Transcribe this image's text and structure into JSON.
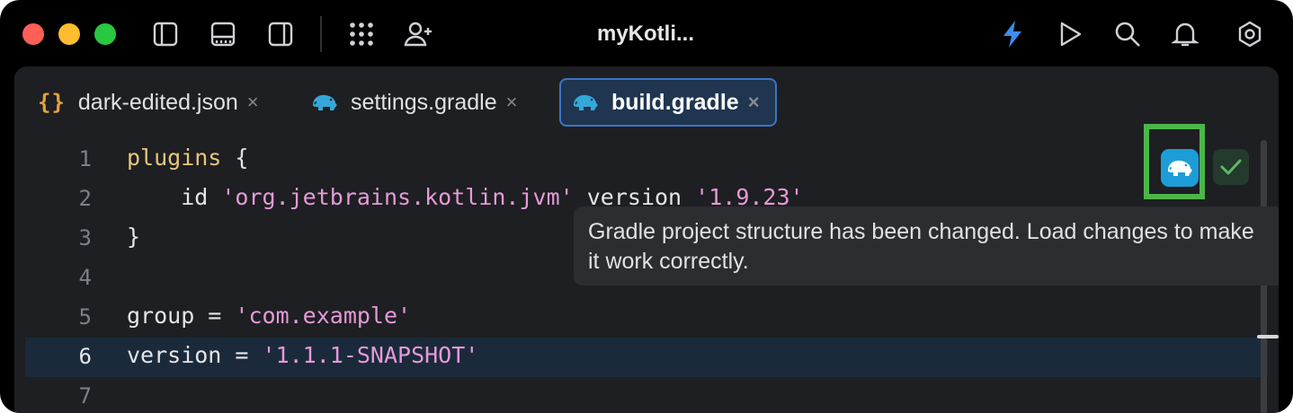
{
  "window": {
    "title": "myKotli..."
  },
  "toolbar": {
    "icons": [
      "sidebar-left-icon",
      "panel-bottom-icon",
      "sidebar-right-icon",
      "apps-grid-icon",
      "add-user-icon",
      "bolt-icon",
      "run-icon",
      "search-icon",
      "bell-icon",
      "settings-icon"
    ]
  },
  "tabs": [
    {
      "label": "dark-edited.json",
      "icon": "{}",
      "active": false
    },
    {
      "label": "settings.gradle",
      "icon": "gradle-elephant-icon",
      "active": false
    },
    {
      "label": "build.gradle",
      "icon": "gradle-elephant-icon",
      "active": true
    }
  ],
  "close_glyph": "×",
  "editor": {
    "current_line": 6,
    "lines": [
      {
        "num": "1",
        "parts": [
          {
            "t": "plugins",
            "c": "kw"
          },
          {
            "t": " {",
            "c": ""
          }
        ]
      },
      {
        "num": "2",
        "parts": [
          {
            "t": "    id ",
            "c": ""
          },
          {
            "t": "'org.jetbrains.kotlin.jvm'",
            "c": "str"
          },
          {
            "t": " version ",
            "c": ""
          },
          {
            "t": "'1.9.23'",
            "c": "str"
          }
        ]
      },
      {
        "num": "3",
        "parts": [
          {
            "t": "}",
            "c": ""
          }
        ]
      },
      {
        "num": "4",
        "parts": []
      },
      {
        "num": "5",
        "parts": [
          {
            "t": "group = ",
            "c": ""
          },
          {
            "t": "'com.example'",
            "c": "str"
          }
        ]
      },
      {
        "num": "6",
        "parts": [
          {
            "t": "version = ",
            "c": ""
          },
          {
            "t": "'1.1.1-SNAPSHOT'",
            "c": "str"
          }
        ]
      },
      {
        "num": "7",
        "parts": []
      }
    ]
  },
  "tooltip": {
    "text": "Gradle project structure has been changed. Load changes to make it work correctly."
  },
  "colors": {
    "accent": "#3d74c6",
    "gradle": "#1d9dd8",
    "highlight": "#4cb64a",
    "string": "#e59ad8",
    "keyword": "#e8c77c"
  }
}
